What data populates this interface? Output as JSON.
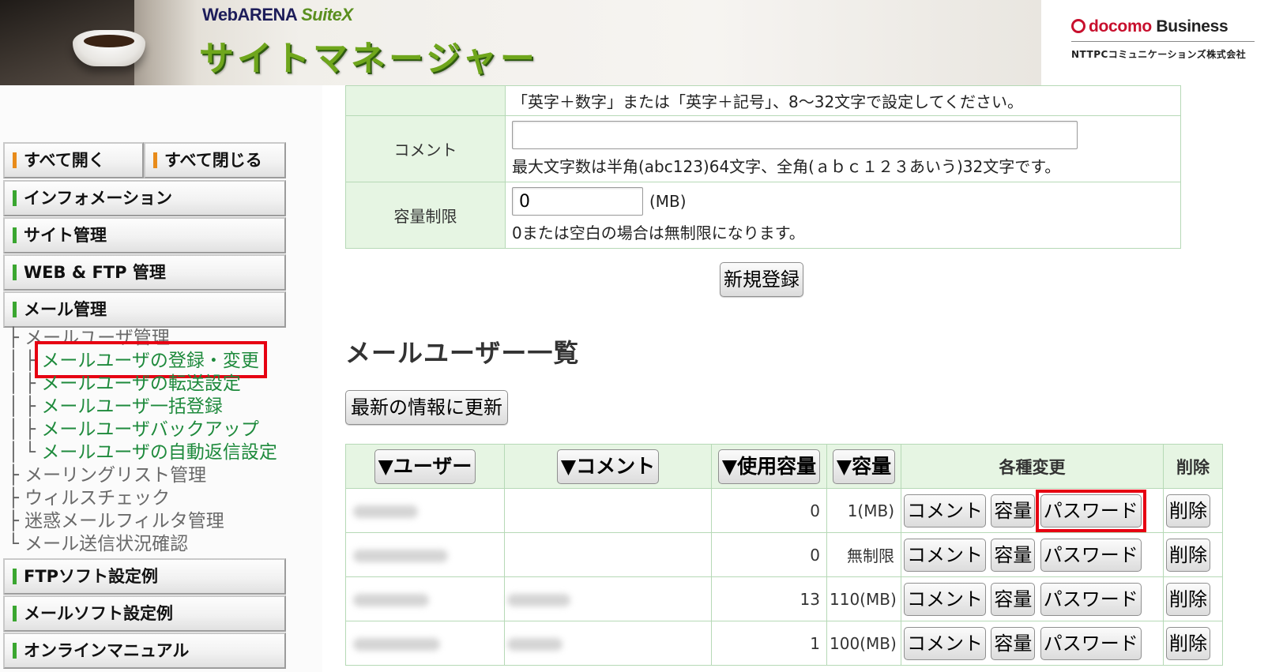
{
  "header": {
    "brand_prefix": "WebARENA",
    "brand_suite": "SuiteX",
    "site_title": "サイトマネージャー",
    "docomo_red": "docomo",
    "docomo_black": "Business",
    "company": "NTTPCコミュニケーションズ株式会社"
  },
  "sidebar": {
    "expand_all": "すべて開く",
    "collapse_all": "すべて閉じる",
    "nav": {
      "information": "インフォメーション",
      "site_admin": "サイト管理",
      "web_ftp": "WEB & FTP 管理",
      "mail_admin": "メール管理",
      "ftp_soft": "FTPソフト設定例",
      "mail_soft": "メールソフト設定例",
      "online_manual": "オンラインマニュアル"
    },
    "tree": {
      "mail_user_admin": "メールユーザ管理",
      "register_change": "メールユーザの登録・変更",
      "forward": "メールユーザの転送設定",
      "bulk": "メールユーザ一括登録",
      "backup": "メールユーザバックアップ",
      "autoreply": "メールユーザの自動返信設定",
      "mailing_list": "メーリングリスト管理",
      "virus": "ウィルスチェック",
      "spam": "迷惑メールフィルタ管理",
      "send_status": "メール送信状況確認"
    }
  },
  "form": {
    "password_hint": "「英字＋数字」または「英字＋記号」、8～32文字で設定してください。",
    "comment_label": "コメント",
    "comment_value": "",
    "comment_hint": "最大文字数は半角(abc123)64文字、全角(ａｂｃ１２３あいう)32文字です。",
    "quota_label": "容量制限",
    "quota_value": "0",
    "quota_unit": "(MB)",
    "quota_hint": "0または空白の場合は無制限になります。",
    "submit": "新規登録"
  },
  "list": {
    "title": "メールユーザー一覧",
    "refresh": "最新の情報に更新",
    "headers": {
      "user": "▼ユーザー",
      "comment": "▼コメント",
      "usage": "▼使用容量",
      "quota": "▼容量",
      "changes": "各種変更",
      "delete": "削除"
    },
    "btn_comment": "コメント",
    "btn_quota": "容量",
    "btn_password": "パスワード",
    "btn_delete": "削除",
    "rows": [
      {
        "usage": "0",
        "quota": "1(MB)"
      },
      {
        "usage": "0",
        "quota": "無制限"
      },
      {
        "usage": "13",
        "quota": "110(MB)"
      },
      {
        "usage": "1",
        "quota": "100(MB)"
      }
    ]
  },
  "colors": {
    "highlight": "#e60012",
    "table_header_bg": "#e6f5e3",
    "link_green": "#1e8a3c"
  }
}
